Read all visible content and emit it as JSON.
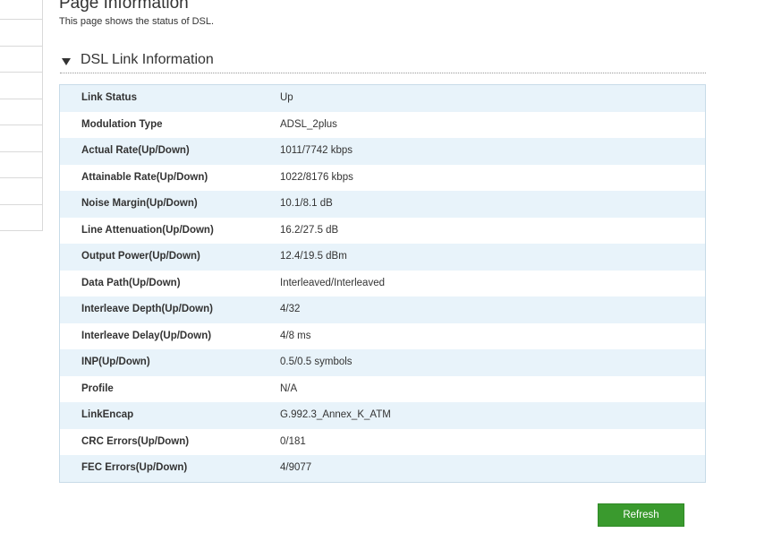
{
  "header": {
    "title": "Page Information",
    "description": "This page shows the status of DSL."
  },
  "section": {
    "title": "DSL Link Information"
  },
  "rows": [
    {
      "label": "Link Status",
      "value": "Up"
    },
    {
      "label": "Modulation Type",
      "value": "ADSL_2plus"
    },
    {
      "label": "Actual Rate(Up/Down)",
      "value": "1011/7742 kbps"
    },
    {
      "label": "Attainable Rate(Up/Down)",
      "value": "1022/8176 kbps"
    },
    {
      "label": "Noise Margin(Up/Down)",
      "value": "10.1/8.1 dB"
    },
    {
      "label": "Line Attenuation(Up/Down)",
      "value": "16.2/27.5 dB"
    },
    {
      "label": "Output Power(Up/Down)",
      "value": "12.4/19.5 dBm"
    },
    {
      "label": "Data Path(Up/Down)",
      "value": "Interleaved/Interleaved"
    },
    {
      "label": "Interleave Depth(Up/Down)",
      "value": "4/32"
    },
    {
      "label": "Interleave Delay(Up/Down)",
      "value": "4/8 ms"
    },
    {
      "label": "INP(Up/Down)",
      "value": "0.5/0.5 symbols"
    },
    {
      "label": "Profile",
      "value": "N/A"
    },
    {
      "label": "LinkEncap",
      "value": "G.992.3_Annex_K_ATM"
    },
    {
      "label": "CRC Errors(Up/Down)",
      "value": "0/181"
    },
    {
      "label": "FEC Errors(Up/Down)",
      "value": "4/9077"
    }
  ],
  "actions": {
    "refresh_label": "Refresh"
  },
  "colors": {
    "row_alt": "#e8f3fa",
    "table_border": "#c8dbe8",
    "button_bg": "#3a9a2e"
  }
}
